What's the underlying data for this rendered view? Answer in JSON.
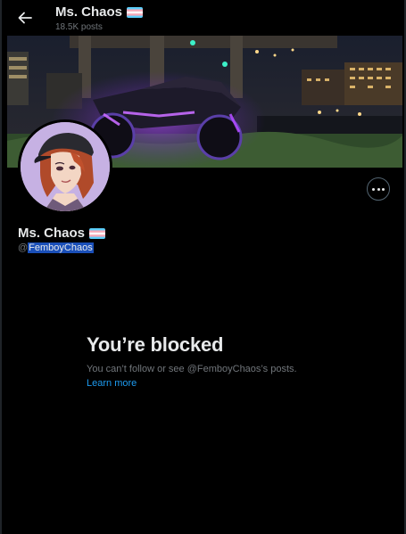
{
  "header": {
    "back_icon": "arrow-left-icon",
    "title": "Ms. Chaos",
    "title_flag": "transgender-flag-emoji",
    "post_count": "18.5K posts"
  },
  "banner": {
    "description_icon": "motorcycle-night-photo"
  },
  "profile": {
    "display_name": "Ms. Chaos",
    "name_flag": "transgender-flag-emoji",
    "handle_prefix": "@",
    "handle": "FemboyChaos",
    "more_icon": "more-horizontal-icon"
  },
  "blocked": {
    "heading": "You’re blocked",
    "message": "You can’t follow or see @FemboyChaos’s posts.",
    "learn_more": "Learn more"
  },
  "colors": {
    "background": "#000000",
    "text_primary": "#e7e9ea",
    "text_secondary": "#71767b",
    "link": "#1d9bf0",
    "selection": "#1a4fb8",
    "flag_blue": "#5bcefa",
    "flag_pink": "#f5a9b8",
    "flag_white": "#ffffff"
  }
}
